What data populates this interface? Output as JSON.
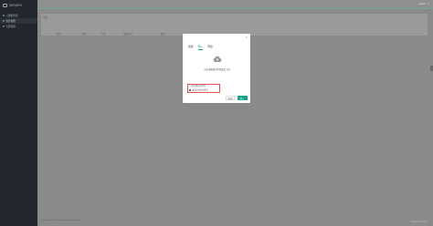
{
  "app": {
    "name": "SERAPH"
  },
  "sidebar": {
    "items": [
      {
        "label": "元数据管理"
      },
      {
        "label": "任务管理"
      },
      {
        "label": "告警管理"
      }
    ]
  },
  "topbar": {
    "user": "admin",
    "caret": "▾"
  },
  "panel": {
    "title": "任务",
    "columns": [
      "名称",
      "类型",
      "状态",
      "创建时间",
      "操作"
    ]
  },
  "modal": {
    "close": "×",
    "tabs": [
      "新建",
      "导入",
      "导出"
    ],
    "active_tab": 1,
    "upload_text": "点击或拖拽文件到此处上传",
    "options": [
      "已存在同名任务时",
      "覆盖已存在的任务"
    ],
    "cancel": "取消",
    "ok": "导入"
  },
  "footer": {
    "left": "Copyright © 2019 Seraph. All Rights Reserved",
    "right": "CSDN @zhangjin"
  }
}
